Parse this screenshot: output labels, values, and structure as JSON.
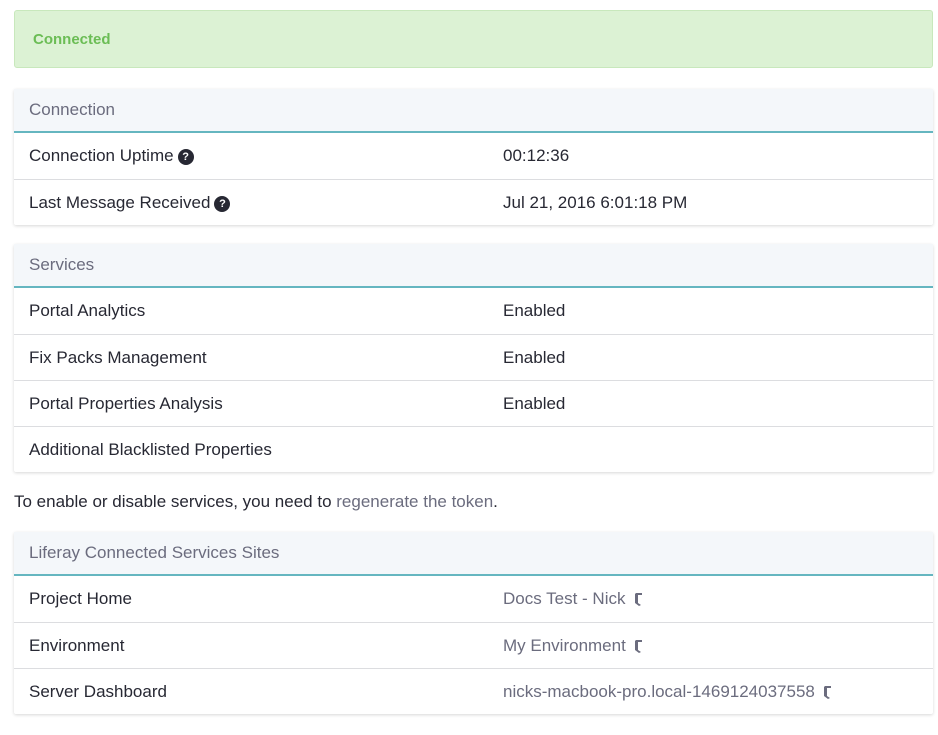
{
  "alert": {
    "text": "Connected"
  },
  "connection": {
    "title": "Connection",
    "rows": [
      {
        "label": "Connection Uptime",
        "value": "00:12:36",
        "help": "?"
      },
      {
        "label": "Last Message Received",
        "value": "Jul 21, 2016 6:01:18 PM",
        "help": "?"
      }
    ]
  },
  "services": {
    "title": "Services",
    "rows": [
      {
        "label": "Portal Analytics",
        "value": "Enabled"
      },
      {
        "label": "Fix Packs Management",
        "value": "Enabled"
      },
      {
        "label": "Portal Properties Analysis",
        "value": "Enabled"
      },
      {
        "label": "Additional Blacklisted Properties",
        "value": ""
      }
    ]
  },
  "note": {
    "prefix": "To enable or disable services, you need to ",
    "link": "regenerate the token",
    "suffix": "."
  },
  "sites": {
    "title": "Liferay Connected Services Sites",
    "rows": [
      {
        "label": "Project Home",
        "value": "Docs Test - Nick"
      },
      {
        "label": "Environment",
        "value": "My Environment"
      },
      {
        "label": "Server Dashboard",
        "value": "nicks-macbook-pro.local-1469124037558"
      }
    ]
  },
  "colors": {
    "alert_bg": "#dcf2d4",
    "alert_text": "#6bbd55",
    "header_accent": "#65b6c0",
    "link": "#6b6c7e"
  },
  "icons": {
    "help": "question-circle-icon",
    "external": "shortcut-icon"
  }
}
